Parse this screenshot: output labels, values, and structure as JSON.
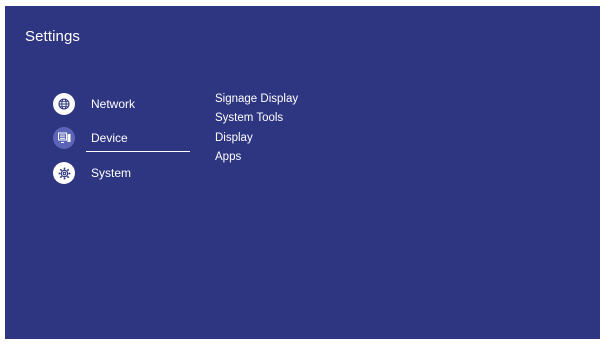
{
  "header": {
    "title": "Settings"
  },
  "sidebar": {
    "items": [
      {
        "label": "Network",
        "icon": "globe-icon",
        "selected": false
      },
      {
        "label": "Device",
        "icon": "device-icon",
        "selected": true
      },
      {
        "label": "System",
        "icon": "gear-icon",
        "selected": false
      }
    ]
  },
  "submenu": {
    "items": [
      {
        "label": "Signage Display"
      },
      {
        "label": "System Tools"
      },
      {
        "label": "Display"
      },
      {
        "label": "Apps"
      }
    ]
  },
  "colors": {
    "background": "#2e3581",
    "icon_bg": "#ffffff",
    "icon_bg_selected": "#5b64b6",
    "icon_fg": "#2e3581",
    "text": "#ffffff"
  }
}
